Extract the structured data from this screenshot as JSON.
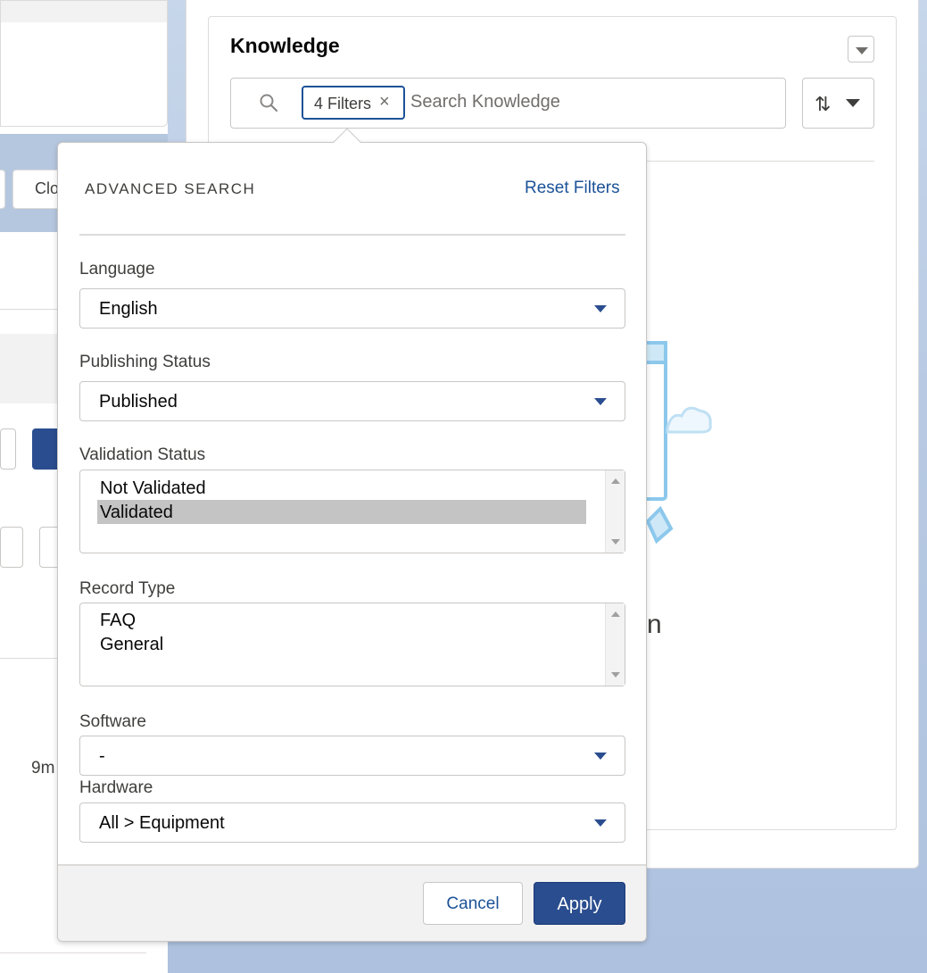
{
  "background": {
    "left_button_label": "Clo",
    "left_timestamp": "9m"
  },
  "knowledge": {
    "title": "Knowledge",
    "filter_pill_label": "4 Filters",
    "filter_pill_remove": "×",
    "search_placeholder": "Search Knowledge",
    "sort_icon_glyph": "⇅",
    "empty_state_partial": "n"
  },
  "advanced_search": {
    "heading": "ADVANCED SEARCH",
    "reset_label": "Reset Filters",
    "language": {
      "label": "Language",
      "value": "English"
    },
    "publishing_status": {
      "label": "Publishing Status",
      "value": "Published"
    },
    "validation_status": {
      "label": "Validation Status",
      "options": [
        "Not Validated",
        "Validated"
      ],
      "selected": "Validated"
    },
    "record_type": {
      "label": "Record Type",
      "options": [
        "FAQ",
        "General"
      ]
    },
    "software": {
      "label": "Software",
      "value": "-"
    },
    "hardware": {
      "label": "Hardware",
      "value": "All > Equipment"
    },
    "cancel_label": "Cancel",
    "apply_label": "Apply"
  },
  "colors": {
    "brand_blue": "#2a4d8f",
    "link_blue": "#1b5297",
    "page_background": "#b5c7df"
  }
}
